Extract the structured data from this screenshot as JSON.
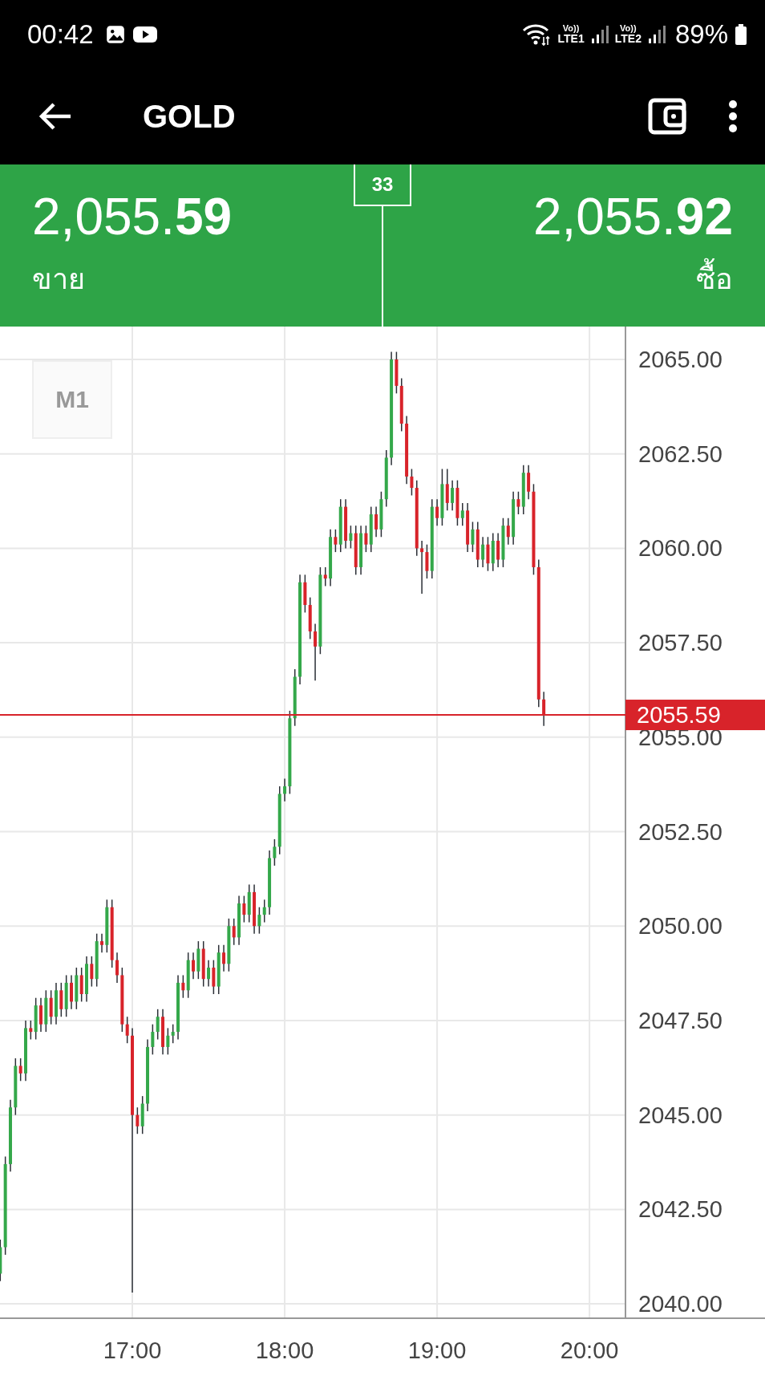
{
  "status_bar": {
    "time": "00:42",
    "networks": [
      {
        "volte": "Vo))",
        "type": "LTE1"
      },
      {
        "volte": "Vo))",
        "type": "LTE2"
      }
    ],
    "battery": "89%"
  },
  "app_bar": {
    "title": "GOLD"
  },
  "quote": {
    "spread": "33",
    "sell": {
      "price": "2,055.",
      "price_bold": "59",
      "label": "ขาย"
    },
    "buy": {
      "price": "2,055.",
      "price_bold": "92",
      "label": "ซื้อ"
    }
  },
  "chart": {
    "timeframe": "M1",
    "chart_data": {
      "type": "candlestick",
      "grid": true,
      "xlim": [
        967.9,
        1269.1
      ],
      "ylim": [
        2039.62,
        2065.87
      ],
      "ref_lines": [
        {
          "axis": "y",
          "value": 2055.59,
          "label": "2055.59",
          "color": "#d8232a"
        }
      ],
      "x": [
        968,
        970,
        972,
        974,
        976,
        978,
        980,
        982,
        984,
        986,
        988,
        990,
        992,
        994,
        996,
        998,
        1000,
        1002,
        1004,
        1006,
        1008,
        1010,
        1012,
        1014,
        1016,
        1018,
        1020,
        1022,
        1024,
        1026,
        1028,
        1030,
        1032,
        1034,
        1036,
        1038,
        1040,
        1042,
        1044,
        1046,
        1048,
        1050,
        1052,
        1054,
        1056,
        1058,
        1060,
        1062,
        1064,
        1066,
        1068,
        1070,
        1072,
        1074,
        1076,
        1078,
        1080,
        1082,
        1084,
        1086,
        1088,
        1090,
        1092,
        1094,
        1096,
        1098,
        1100,
        1102,
        1104,
        1106,
        1108,
        1110,
        1112,
        1114,
        1116,
        1118,
        1120,
        1122,
        1124,
        1126,
        1128,
        1130,
        1132,
        1134,
        1136,
        1138,
        1140,
        1142,
        1144,
        1146,
        1148,
        1150,
        1152,
        1154,
        1156,
        1158,
        1160,
        1162,
        1164,
        1166,
        1168,
        1170,
        1172,
        1174,
        1176,
        1178,
        1180,
        1182
      ],
      "ohlc": [
        [
          2040.8,
          2041.7,
          2040.6,
          2041.5
        ],
        [
          2041.5,
          2043.9,
          2041.3,
          2043.7
        ],
        [
          2043.7,
          2045.4,
          2043.5,
          2045.2
        ],
        [
          2045.2,
          2046.5,
          2045.0,
          2046.3
        ],
        [
          2046.3,
          2046.5,
          2045.9,
          2046.1
        ],
        [
          2046.1,
          2047.5,
          2045.9,
          2047.3
        ],
        [
          2047.3,
          2047.5,
          2047.0,
          2047.2
        ],
        [
          2047.2,
          2048.1,
          2047.0,
          2047.9
        ],
        [
          2047.9,
          2048.1,
          2047.2,
          2047.4
        ],
        [
          2047.4,
          2048.3,
          2047.2,
          2048.1
        ],
        [
          2048.1,
          2048.3,
          2047.4,
          2047.6
        ],
        [
          2047.6,
          2048.5,
          2047.4,
          2048.3
        ],
        [
          2048.3,
          2048.5,
          2047.6,
          2047.8
        ],
        [
          2047.8,
          2048.7,
          2047.6,
          2048.5
        ],
        [
          2048.5,
          2048.7,
          2047.8,
          2048.0
        ],
        [
          2048.0,
          2048.9,
          2047.8,
          2048.7
        ],
        [
          2048.7,
          2048.9,
          2048.0,
          2048.2
        ],
        [
          2048.2,
          2049.2,
          2048.0,
          2049.0
        ],
        [
          2049.0,
          2049.2,
          2048.4,
          2048.6
        ],
        [
          2048.6,
          2049.8,
          2048.4,
          2049.6
        ],
        [
          2049.6,
          2049.8,
          2049.3,
          2049.5
        ],
        [
          2049.5,
          2050.7,
          2049.3,
          2050.5
        ],
        [
          2050.5,
          2050.7,
          2048.9,
          2049.1
        ],
        [
          2049.1,
          2049.3,
          2048.5,
          2048.7
        ],
        [
          2048.7,
          2048.9,
          2047.2,
          2047.4
        ],
        [
          2047.4,
          2047.6,
          2046.9,
          2047.1
        ],
        [
          2047.1,
          2047.3,
          2040.3,
          2045.0
        ],
        [
          2045.0,
          2045.2,
          2044.5,
          2044.7
        ],
        [
          2044.7,
          2045.5,
          2044.5,
          2045.3
        ],
        [
          2045.3,
          2047.0,
          2045.1,
          2046.8
        ],
        [
          2046.8,
          2047.4,
          2046.6,
          2047.2
        ],
        [
          2047.2,
          2047.8,
          2047.0,
          2047.6
        ],
        [
          2047.6,
          2047.8,
          2046.6,
          2046.8
        ],
        [
          2046.8,
          2047.3,
          2046.6,
          2047.1
        ],
        [
          2047.1,
          2047.4,
          2046.9,
          2047.2
        ],
        [
          2047.2,
          2048.7,
          2047.0,
          2048.5
        ],
        [
          2048.5,
          2048.7,
          2048.1,
          2048.3
        ],
        [
          2048.3,
          2049.3,
          2048.1,
          2049.1
        ],
        [
          2049.1,
          2049.3,
          2048.6,
          2048.8
        ],
        [
          2048.8,
          2049.6,
          2048.6,
          2049.4
        ],
        [
          2049.4,
          2049.6,
          2048.4,
          2048.6
        ],
        [
          2048.6,
          2049.1,
          2048.4,
          2048.9
        ],
        [
          2048.9,
          2049.1,
          2048.2,
          2048.4
        ],
        [
          2048.4,
          2049.5,
          2048.2,
          2049.3
        ],
        [
          2049.3,
          2049.5,
          2048.8,
          2049.0
        ],
        [
          2049.0,
          2050.2,
          2048.8,
          2050.0
        ],
        [
          2050.0,
          2050.2,
          2049.5,
          2049.7
        ],
        [
          2049.7,
          2050.8,
          2049.5,
          2050.6
        ],
        [
          2050.6,
          2050.8,
          2050.1,
          2050.3
        ],
        [
          2050.3,
          2051.1,
          2050.1,
          2050.9
        ],
        [
          2050.9,
          2051.1,
          2049.8,
          2050.0
        ],
        [
          2050.0,
          2050.5,
          2049.8,
          2050.3
        ],
        [
          2050.3,
          2050.7,
          2050.1,
          2050.5
        ],
        [
          2050.5,
          2052.0,
          2050.3,
          2051.8
        ],
        [
          2051.8,
          2052.3,
          2051.6,
          2052.1
        ],
        [
          2052.1,
          2053.7,
          2051.9,
          2053.5
        ],
        [
          2053.5,
          2053.9,
          2053.3,
          2053.7
        ],
        [
          2053.7,
          2055.7,
          2053.5,
          2055.5
        ],
        [
          2055.5,
          2056.8,
          2055.3,
          2056.6
        ],
        [
          2056.6,
          2059.3,
          2056.4,
          2059.1
        ],
        [
          2059.1,
          2059.3,
          2058.3,
          2058.5
        ],
        [
          2058.5,
          2058.7,
          2057.6,
          2057.8
        ],
        [
          2057.8,
          2058.0,
          2056.5,
          2057.4
        ],
        [
          2057.4,
          2059.5,
          2057.2,
          2059.3
        ],
        [
          2059.3,
          2059.5,
          2059.0,
          2059.2
        ],
        [
          2059.2,
          2060.5,
          2059.0,
          2060.3
        ],
        [
          2060.3,
          2060.5,
          2059.9,
          2060.1
        ],
        [
          2060.1,
          2061.3,
          2059.9,
          2061.1
        ],
        [
          2061.1,
          2061.3,
          2060.0,
          2060.2
        ],
        [
          2060.2,
          2060.6,
          2060.0,
          2060.4
        ],
        [
          2060.4,
          2060.6,
          2059.3,
          2059.5
        ],
        [
          2059.5,
          2060.6,
          2059.3,
          2060.4
        ],
        [
          2060.4,
          2060.6,
          2059.9,
          2060.1
        ],
        [
          2060.1,
          2061.1,
          2059.9,
          2060.9
        ],
        [
          2060.9,
          2061.1,
          2060.3,
          2060.5
        ],
        [
          2060.5,
          2061.5,
          2060.3,
          2061.3
        ],
        [
          2061.3,
          2062.6,
          2061.1,
          2062.4
        ],
        [
          2062.4,
          2065.2,
          2062.2,
          2065.0
        ],
        [
          2065.0,
          2065.2,
          2064.1,
          2064.3
        ],
        [
          2064.3,
          2064.5,
          2063.1,
          2063.3
        ],
        [
          2063.3,
          2063.5,
          2061.7,
          2061.9
        ],
        [
          2061.9,
          2062.1,
          2061.4,
          2061.6
        ],
        [
          2061.6,
          2061.8,
          2059.8,
          2060.0
        ],
        [
          2060.0,
          2060.2,
          2058.8,
          2059.9
        ],
        [
          2059.9,
          2060.1,
          2059.2,
          2059.4
        ],
        [
          2059.4,
          2061.3,
          2059.2,
          2061.1
        ],
        [
          2061.1,
          2061.3,
          2060.6,
          2060.8
        ],
        [
          2060.8,
          2062.1,
          2060.6,
          2061.7
        ],
        [
          2061.7,
          2062.1,
          2061.0,
          2061.2
        ],
        [
          2061.2,
          2061.8,
          2061.0,
          2061.6
        ],
        [
          2061.6,
          2061.8,
          2060.6,
          2060.8
        ],
        [
          2060.8,
          2061.2,
          2060.6,
          2061.0
        ],
        [
          2061.0,
          2061.2,
          2059.9,
          2060.1
        ],
        [
          2060.1,
          2060.7,
          2059.9,
          2060.5
        ],
        [
          2060.5,
          2060.7,
          2059.5,
          2059.7
        ],
        [
          2059.7,
          2060.3,
          2059.5,
          2060.1
        ],
        [
          2060.1,
          2060.3,
          2059.4,
          2059.6
        ],
        [
          2059.6,
          2060.4,
          2059.4,
          2060.2
        ],
        [
          2060.2,
          2060.4,
          2059.5,
          2059.7
        ],
        [
          2059.7,
          2060.8,
          2059.5,
          2060.6
        ],
        [
          2060.6,
          2060.8,
          2060.1,
          2060.3
        ],
        [
          2060.3,
          2061.5,
          2060.1,
          2061.3
        ],
        [
          2061.3,
          2061.5,
          2060.9,
          2061.1
        ],
        [
          2061.1,
          2062.2,
          2060.9,
          2062.0
        ],
        [
          2062.0,
          2062.2,
          2061.3,
          2061.5
        ],
        [
          2061.5,
          2061.7,
          2059.3,
          2059.5
        ],
        [
          2059.5,
          2059.7,
          2055.8,
          2056.0
        ],
        [
          2056.0,
          2056.2,
          2055.3,
          2055.59
        ]
      ],
      "yticks": [
        {
          "value": 2065,
          "label": "2065.00"
        },
        {
          "value": 2062.5,
          "label": "2062.50"
        },
        {
          "value": 2060,
          "label": "2060.00"
        },
        {
          "value": 2057.5,
          "label": "2057.50"
        },
        {
          "value": 2055,
          "label": "2055.00"
        },
        {
          "value": 2052.5,
          "label": "2052.50"
        },
        {
          "value": 2050,
          "label": "2050.00"
        },
        {
          "value": 2047.5,
          "label": "2047.50"
        },
        {
          "value": 2045,
          "label": "2045.00"
        },
        {
          "value": 2042.5,
          "label": "2042.50"
        },
        {
          "value": 2040,
          "label": "2040.00"
        }
      ],
      "xticks": [
        {
          "value": 1020,
          "label": "17:00"
        },
        {
          "value": 1080,
          "label": "18:00"
        },
        {
          "value": 1140,
          "label": "19:00"
        },
        {
          "value": 1200,
          "label": "20:00"
        }
      ]
    }
  }
}
